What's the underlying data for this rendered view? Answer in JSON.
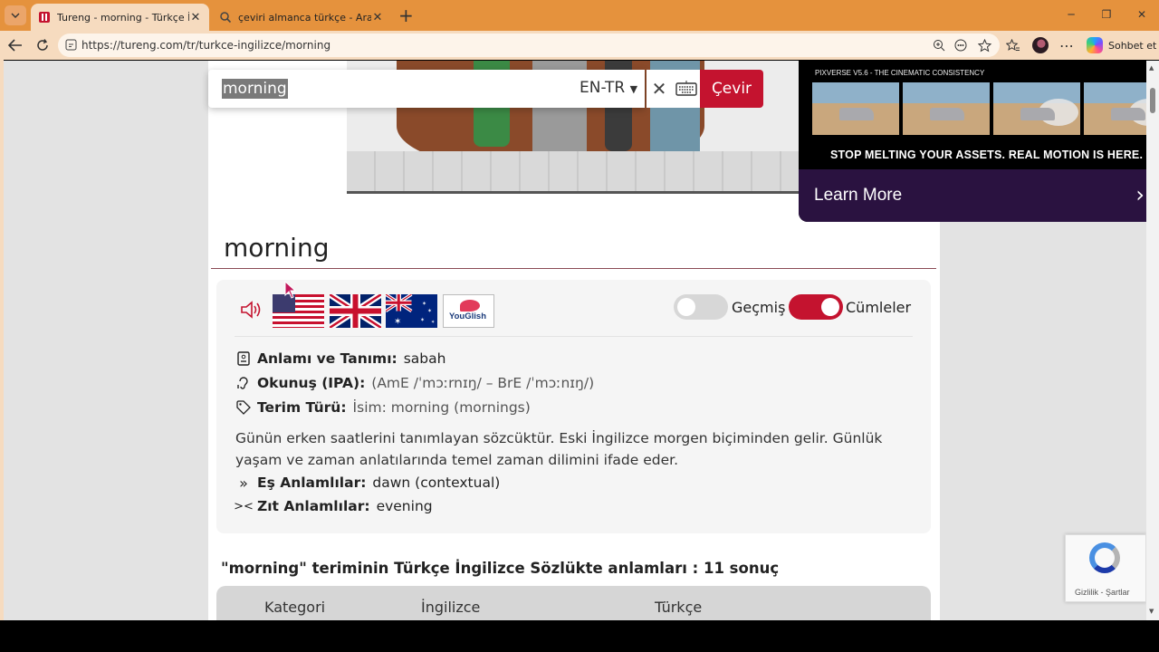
{
  "browser": {
    "tabs": [
      {
        "title": "Tureng - morning - Türkçe İngilizce Sözlük",
        "active": true,
        "favicon": "tureng-icon"
      },
      {
        "title": "çeviri almanca türkçe - Arama",
        "active": false,
        "favicon": "search-icon"
      }
    ],
    "url": "https://tureng.com/tr/turkce-ingilizce/morning",
    "copilot_label": "Sohbet et",
    "accent": "#e5923d"
  },
  "search": {
    "query": "morning",
    "language": "EN-TR",
    "translate_label": "Çevir",
    "accent": "#c4132f"
  },
  "ad": {
    "small_text": "PIXVERSE V5.6 - THE CINEMATIC CONSISTENCY",
    "tagline": "STOP MELTING YOUR ASSETS.  REAL MOTION IS HERE.",
    "cta": "Learn More"
  },
  "entry": {
    "word": "morning",
    "toggles": {
      "history_label": "Geçmiş",
      "history_on": false,
      "sentences_label": "Cümleler",
      "sentences_on": true
    },
    "meaning_label": "Anlamı ve Tanımı:",
    "meaning": "sabah",
    "ipa_label": "Okunuş (IPA):",
    "ipa": "(AmE /ˈmɔːrnɪŋ/ – BrE /ˈmɔːnɪŋ/)",
    "type_label": "Terim Türü:",
    "type": "İsim: morning (mornings)",
    "description": "Günün erken saatlerini tanımlayan sözcüktür. Eski İngilizce morgen biçiminden gelir. Günlük yaşam ve zaman anlatılarında temel zaman dilimini ifade eder.",
    "synonyms_label": "Eş Anlamlılar:",
    "synonyms": "dawn (contextual)",
    "antonyms_label": "Zıt Anlamlılar:",
    "antonyms": "evening",
    "youglish": "YouGlish"
  },
  "results": {
    "title": "\"morning\" teriminin Türkçe İngilizce Sözlükte anlamları : 11 sonuç",
    "columns": [
      "Kategori",
      "İngilizce",
      "Türkçe"
    ]
  },
  "recaptcha": {
    "text": "Gizlilik - Şartlar"
  }
}
